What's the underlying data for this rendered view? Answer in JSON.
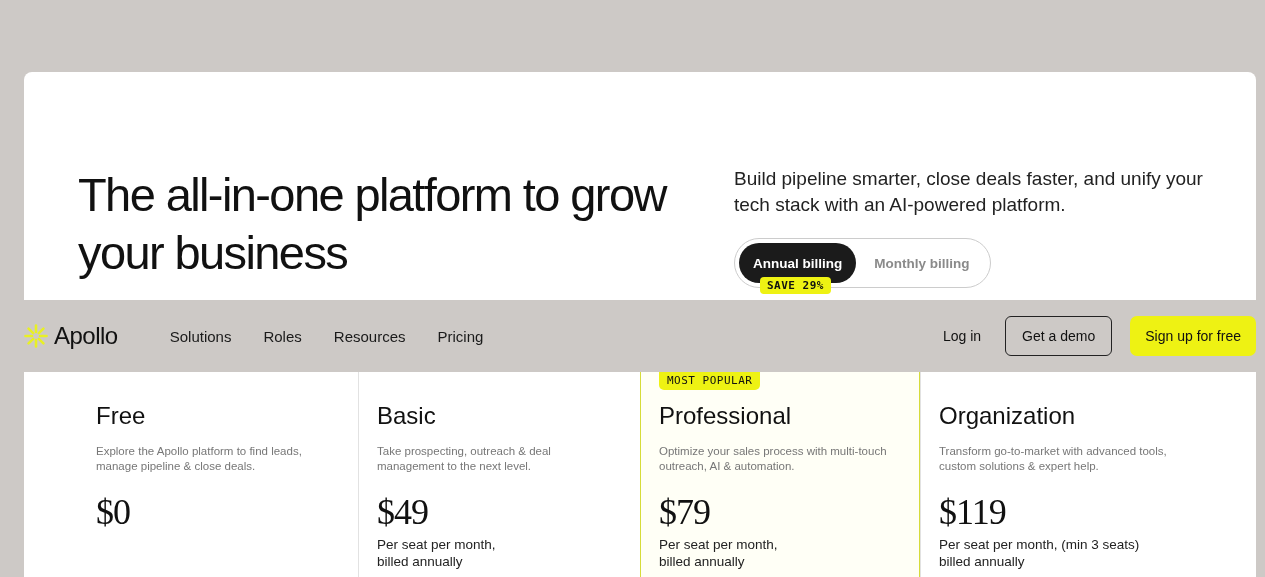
{
  "hero": {
    "title": "The all-in-one platform to grow your business",
    "subtitle": "Build pipeline smarter, close deals faster, and unify your tech stack with an AI-powered platform."
  },
  "billing_toggle": {
    "options": [
      {
        "label": "Annual billing",
        "selected": true
      },
      {
        "label": "Monthly billing",
        "selected": false
      }
    ],
    "badge": "SAVE 29%"
  },
  "nav": {
    "brand": "Apollo",
    "links": [
      "Solutions",
      "Roles",
      "Resources",
      "Pricing"
    ],
    "login": "Log in",
    "demo": "Get a demo",
    "signup": "Sign up for free"
  },
  "plans": [
    {
      "name": "Free",
      "description": "Explore the Apollo platform to find leads, manage pipeline & close deals.",
      "price": "$0",
      "highlighted": false
    },
    {
      "name": "Basic",
      "description": "Take prospecting, outreach & deal management to the next level.",
      "price": "$49",
      "billing": [
        "Per seat per month,",
        "billed annually"
      ],
      "highlighted": false
    },
    {
      "name": "Professional",
      "description": "Optimize your sales process with multi-touch outreach, AI & automation.",
      "price": "$79",
      "billing": [
        "Per seat per month,",
        "billed annually"
      ],
      "highlighted": true,
      "badge": "MOST POPULAR"
    },
    {
      "name": "Organization",
      "description": "Transform go-to-market with advanced tools, custom solutions & expert help.",
      "price": "$119",
      "billing": [
        "Per seat per month, (min 3 seats)",
        "billed annually"
      ],
      "highlighted": false
    }
  ]
}
